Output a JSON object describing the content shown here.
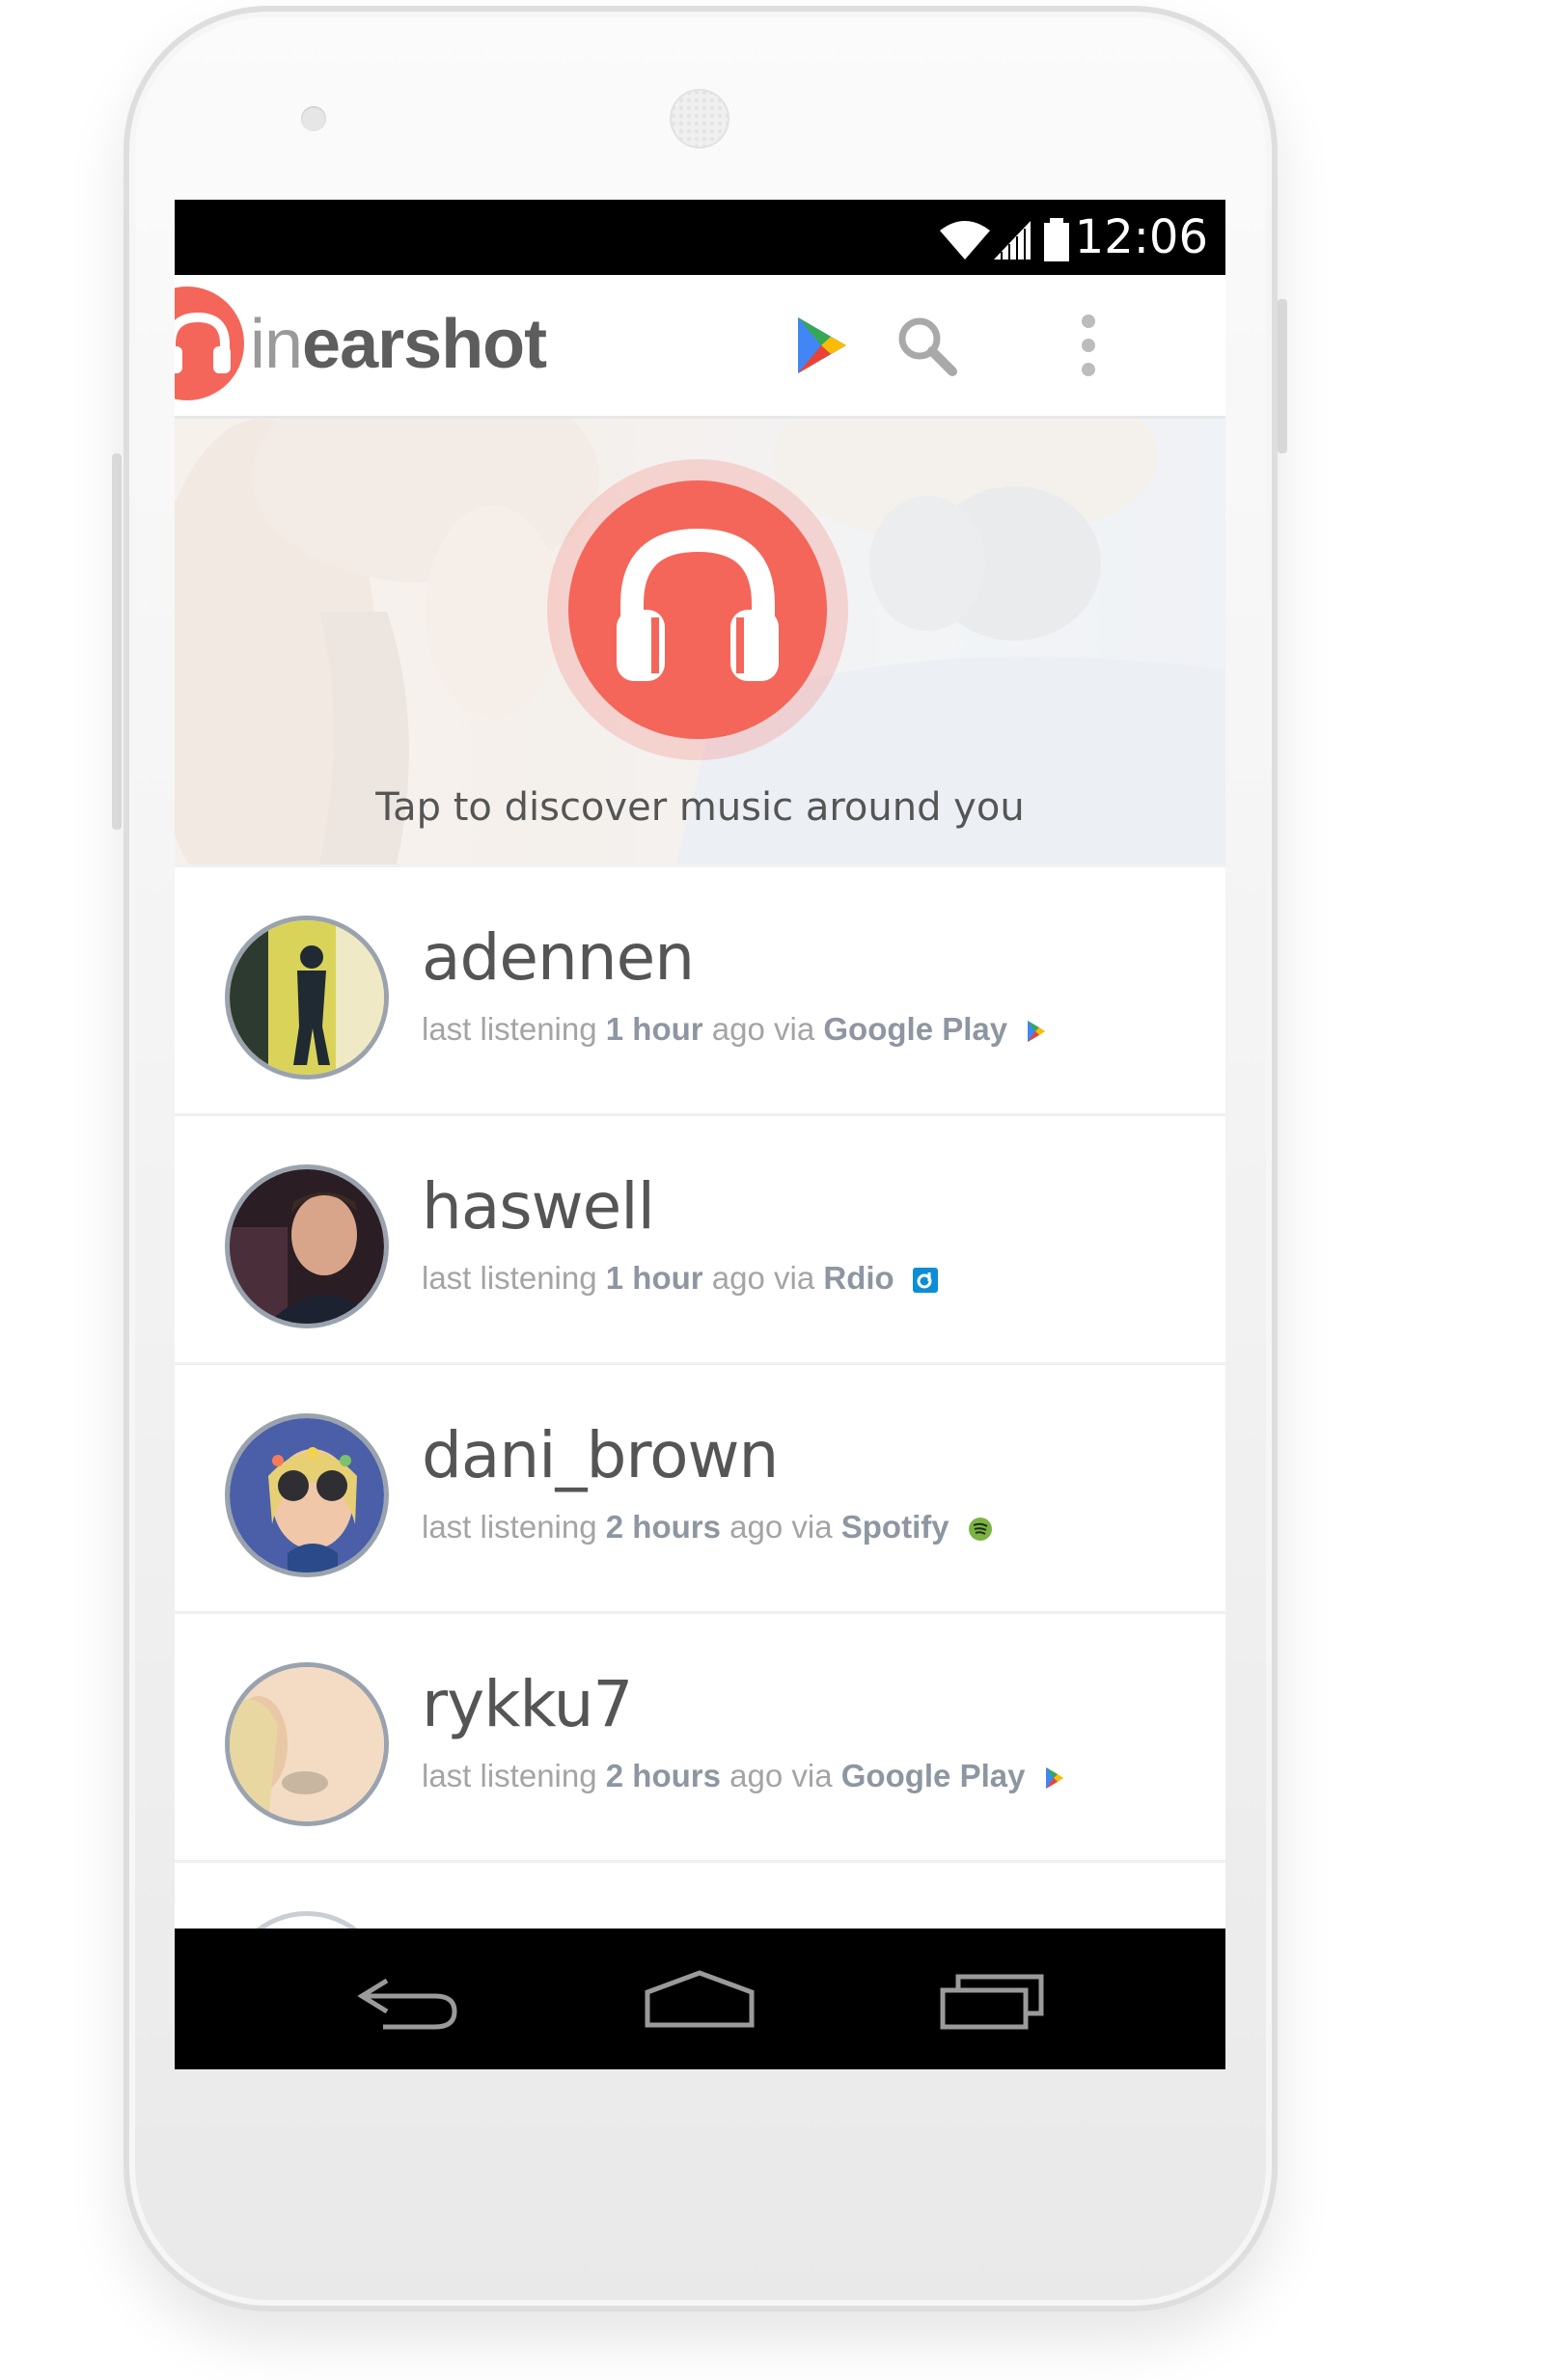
{
  "status_bar": {
    "time": "12:06"
  },
  "app_bar": {
    "title_prefix": "in",
    "title_rest": "earshot",
    "icons": [
      "google-play-icon",
      "search-icon",
      "overflow-menu-icon"
    ]
  },
  "hero": {
    "caption": "Tap to discover music around you",
    "button_icon": "headphones-icon"
  },
  "listeners": [
    {
      "username": "adennen",
      "prefix": "last listening",
      "time": "1 hour",
      "mid": "ago via",
      "service": "Google Play",
      "service_icon": "google-play-icon"
    },
    {
      "username": "haswell",
      "prefix": "last listening",
      "time": "1 hour",
      "mid": "ago via",
      "service": "Rdio",
      "service_icon": "rdio-icon"
    },
    {
      "username": "dani_brown",
      "prefix": "last listening",
      "time": "2 hours",
      "mid": "ago via",
      "service": "Spotify",
      "service_icon": "spotify-icon"
    },
    {
      "username": "rykku7",
      "prefix": "last listening",
      "time": "2 hours",
      "mid": "ago via",
      "service": "Google Play",
      "service_icon": "google-play-icon"
    }
  ],
  "nav_bar": {
    "buttons": [
      "back-icon",
      "home-icon",
      "recents-icon"
    ]
  },
  "colors": {
    "accent": "#f4665a",
    "status_bar": "#000000",
    "nav_bar": "#000000"
  }
}
